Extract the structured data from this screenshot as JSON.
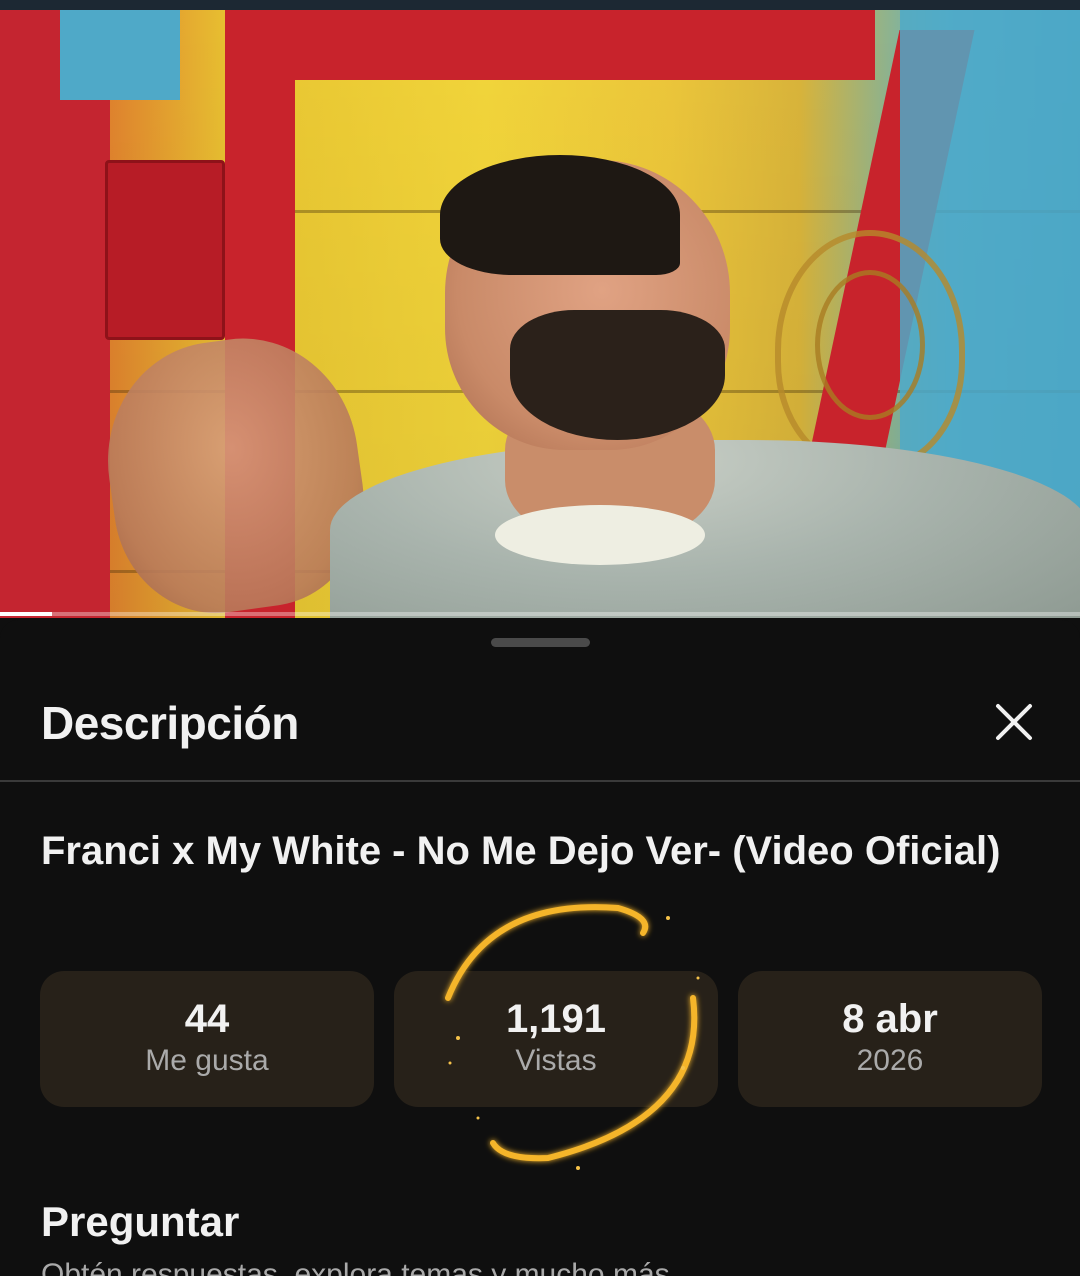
{
  "video": {
    "player_label": "video-player",
    "progress": 0.048
  },
  "sheet": {
    "title": "Descripción",
    "close_icon": "close-icon"
  },
  "details": {
    "video_title": "Franci x My White - No Me Dejo Ver- (Video Oficial)",
    "stats": [
      {
        "value": "44",
        "label": "Me gusta"
      },
      {
        "value": "1,191",
        "label": "Vistas"
      },
      {
        "value": "8 abr",
        "label": "2026"
      }
    ]
  },
  "ask": {
    "title": "Preguntar",
    "subtitle": "Obtén respuestas, explora temas y mucho más"
  },
  "colors": {
    "background": "#0f0f0f",
    "stat_card": "#272119",
    "ring_gold": "#f5b52a"
  }
}
